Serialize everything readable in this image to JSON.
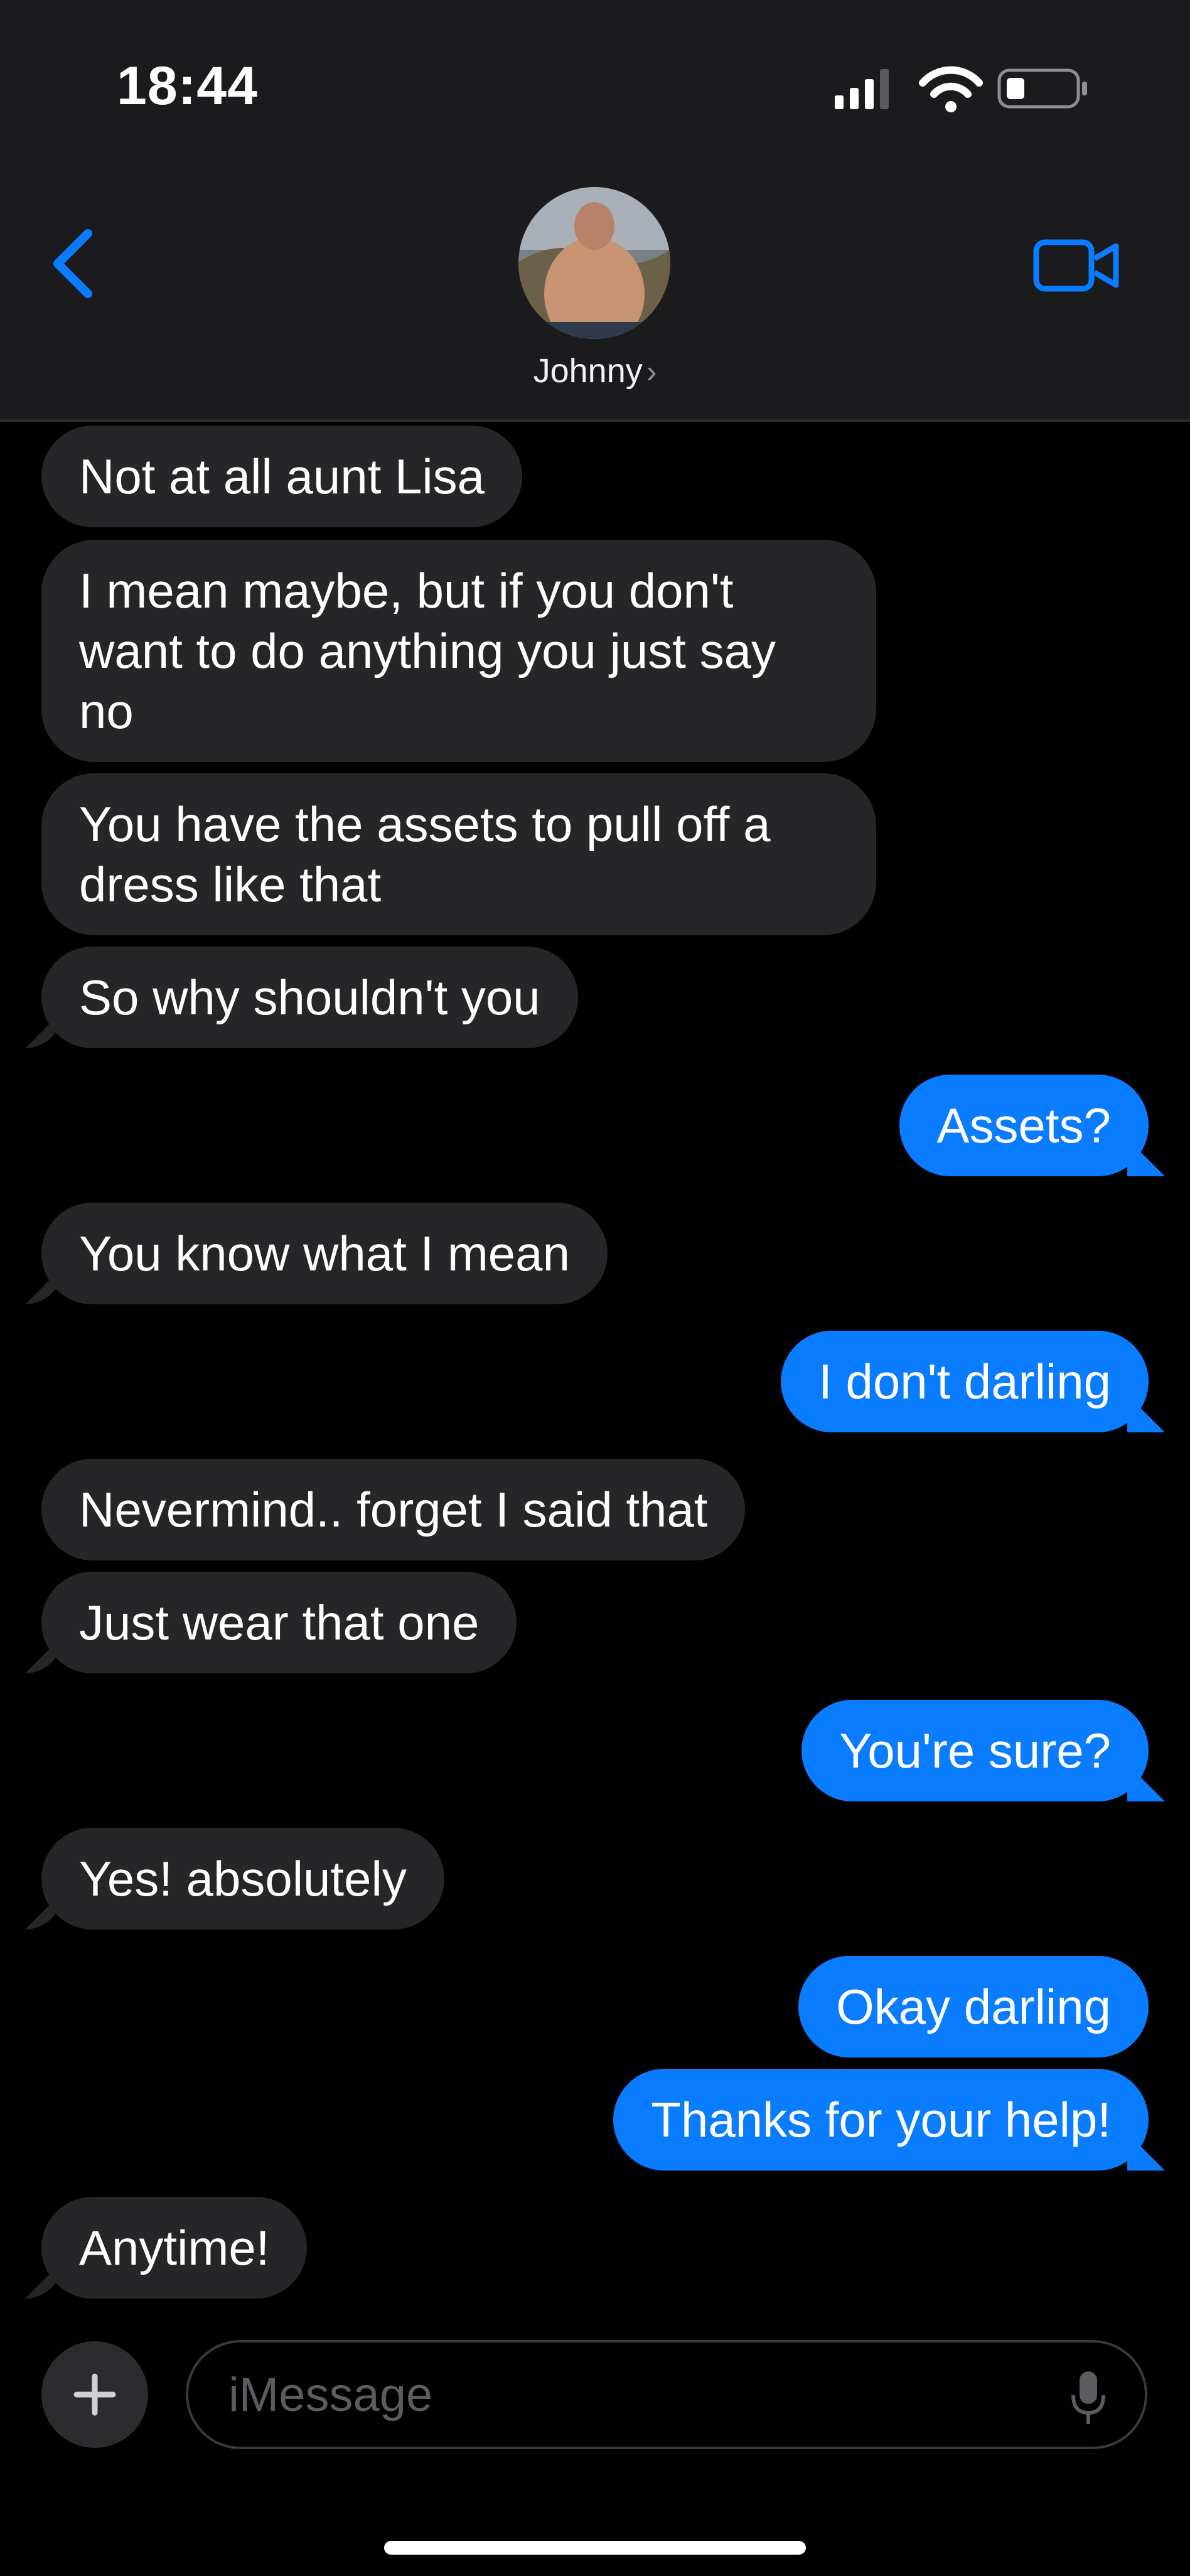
{
  "status_bar": {
    "time": "18:44"
  },
  "header": {
    "contact_name": "Johnny",
    "chevron": "›"
  },
  "messages": [
    {
      "dir": "in",
      "text": "Not at all aunt Lisa"
    },
    {
      "dir": "in",
      "text": "I mean maybe, but if you don't want to do anything you just say no"
    },
    {
      "dir": "in",
      "text": "You have the assets to pull off a dress like that"
    },
    {
      "dir": "in",
      "text": "So why shouldn't you"
    },
    {
      "dir": "out",
      "text": "Assets?"
    },
    {
      "dir": "in",
      "text": "You know what I mean"
    },
    {
      "dir": "out",
      "text": "I don't darling"
    },
    {
      "dir": "in",
      "text": "Nevermind.. forget I said that"
    },
    {
      "dir": "in",
      "text": "Just wear that one"
    },
    {
      "dir": "out",
      "text": "You're sure?"
    },
    {
      "dir": "in",
      "text": "Yes! absolutely"
    },
    {
      "dir": "out",
      "text": "Okay darling"
    },
    {
      "dir": "out",
      "text": "Thanks for your help!"
    },
    {
      "dir": "in",
      "text": "Anytime!"
    }
  ],
  "composer": {
    "placeholder": "iMessage",
    "plus_label": "+"
  },
  "colors": {
    "accent": "#0a7cff",
    "incoming_bubble": "#262629",
    "header_bg": "#1b1b1d"
  },
  "icons": [
    "back-chevron-icon",
    "video-camera-icon",
    "signal-icon",
    "wifi-icon",
    "battery-icon",
    "microphone-icon",
    "plus-icon"
  ]
}
